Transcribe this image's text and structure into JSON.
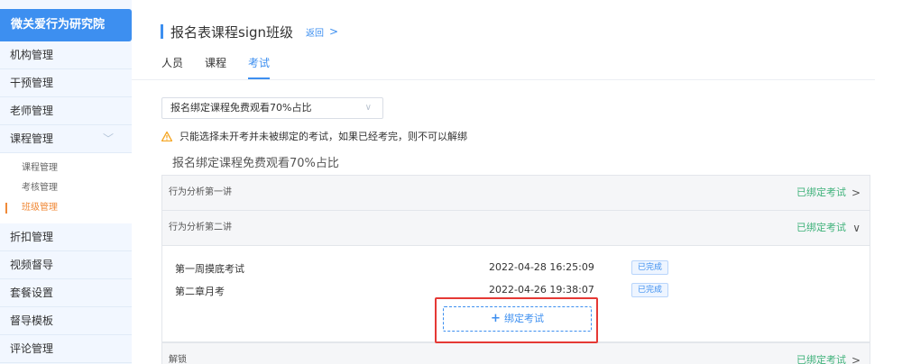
{
  "sidebar": {
    "brand": "微关爱行为研究院",
    "items_top": [
      {
        "label": "机构管理"
      },
      {
        "label": "干预管理"
      },
      {
        "label": "老师管理"
      },
      {
        "label": "课程管理"
      }
    ],
    "sub_items": [
      {
        "label": "课程管理"
      },
      {
        "label": "考核管理"
      },
      {
        "label": "班级管理"
      }
    ],
    "items_bottom": [
      {
        "label": "折扣管理"
      },
      {
        "label": "视频督导"
      },
      {
        "label": "套餐设置"
      },
      {
        "label": "督导模板"
      },
      {
        "label": "评论管理"
      }
    ]
  },
  "header": {
    "title": "报名表课程sign班级",
    "back_label": "返回"
  },
  "tabs": [
    {
      "label": "人员"
    },
    {
      "label": "课程"
    },
    {
      "label": "考试"
    }
  ],
  "course_select": {
    "value": "报名绑定课程免费观看70%占比"
  },
  "warning_text": "只能选择未开考并未被绑定的考试，如果已经考完，则不可以解绑",
  "subtitle": "报名绑定课程免费观看70%占比",
  "panels": [
    {
      "title": "行为分析第一讲",
      "status": "已绑定考试"
    },
    {
      "title": "行为分析第二讲",
      "status": "已绑定考试"
    },
    {
      "title": "解锁",
      "status": "已绑定考试"
    }
  ],
  "exams": [
    {
      "name": "第一周摸底考试",
      "time": "2022-04-28 16:25:09",
      "status": "已完成"
    },
    {
      "name": "第二章月考",
      "time": "2022-04-26 19:38:07",
      "status": "已完成"
    }
  ],
  "bind_button_label": "绑定考试",
  "colors": {
    "accent": "#3d8ff0",
    "success": "#3fb27a",
    "active_sub": "#f08a39",
    "warning": "#f5a623",
    "highlight": "#e53935"
  }
}
